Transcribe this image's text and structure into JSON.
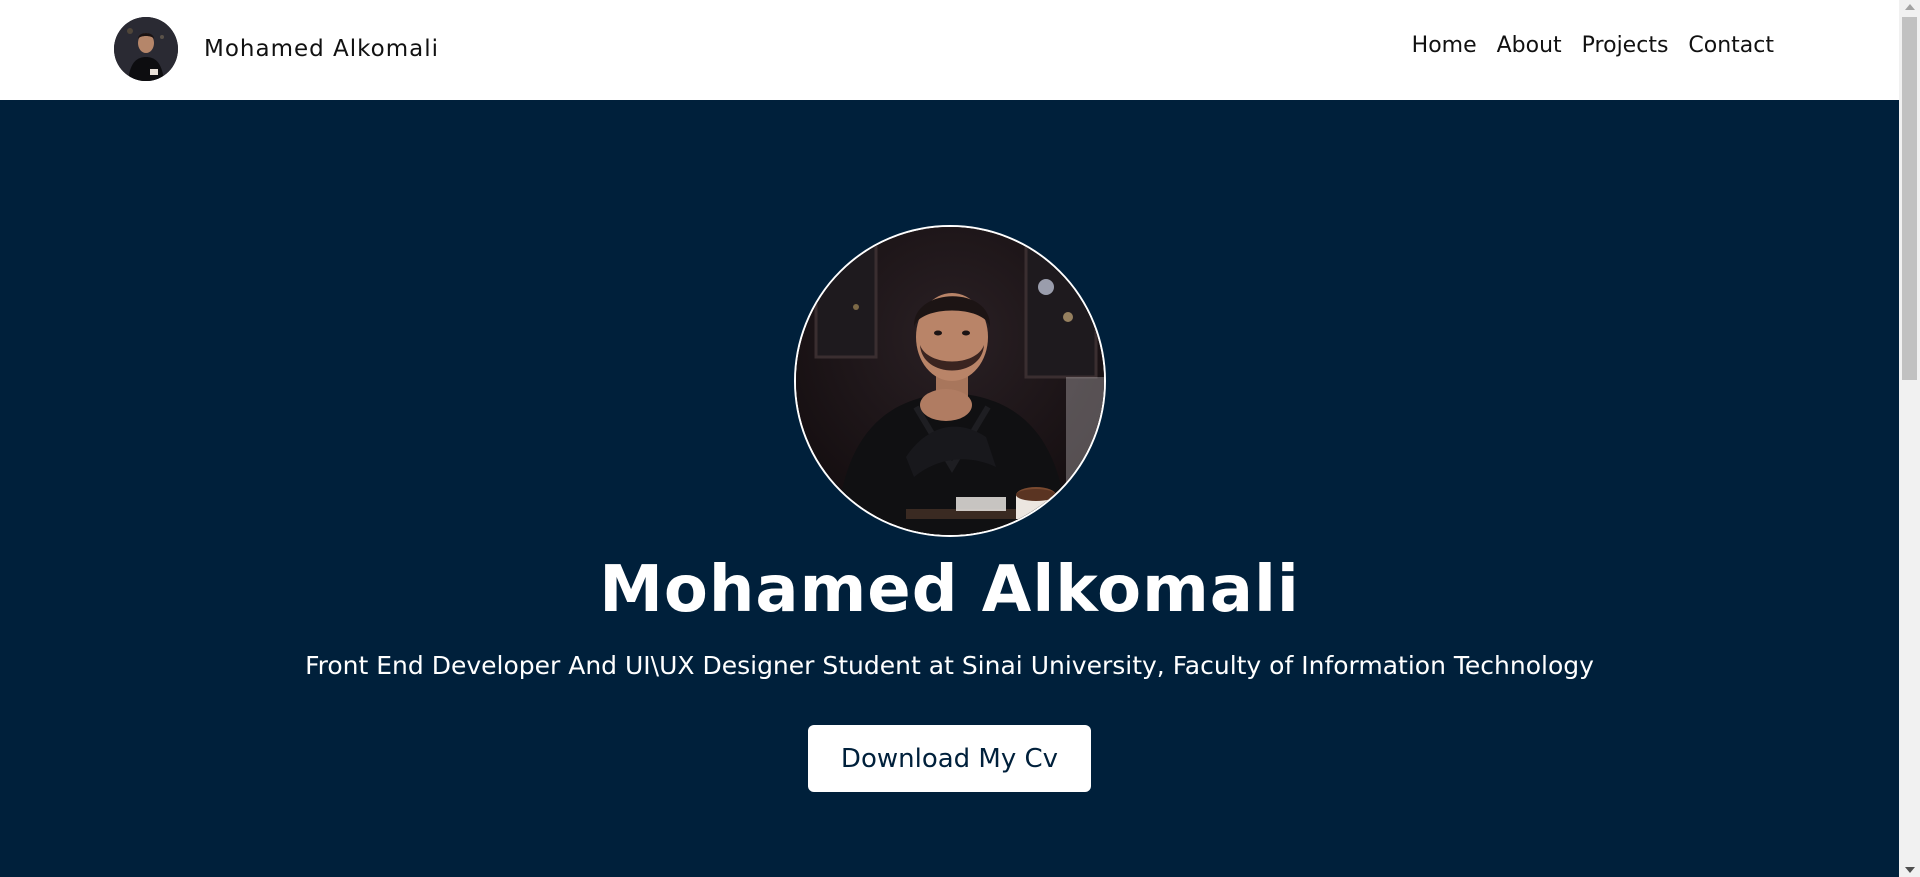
{
  "navbar": {
    "brand_name": "Mohamed Alkomali",
    "avatar_icon": "profile-photo",
    "links": [
      {
        "label": "Home"
      },
      {
        "label": "About"
      },
      {
        "label": "Projects"
      },
      {
        "label": "Contact"
      }
    ]
  },
  "hero": {
    "photo_icon": "portrait-photo",
    "name": "Mohamed Alkomali",
    "subtitle": "Front End Developer And UI\\UX Designer Student at Sinai University, Faculty of Information Technology",
    "cv_button_label": "Download My Cv"
  },
  "colors": {
    "hero_background": "#00203b",
    "navbar_background": "#ffffff",
    "button_text": "#00203b"
  }
}
